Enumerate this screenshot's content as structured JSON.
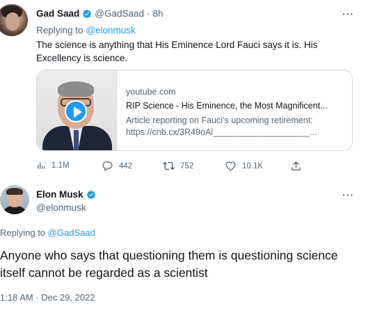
{
  "tweet1": {
    "author_name": "Gad Saad",
    "author_handle": "@GadSaad",
    "separator": "·",
    "time": "8h",
    "replying_prefix": "Replying to",
    "replying_to": "@elonmusk",
    "text": "The science is anything that His Eminence Lord Fauci says it is. His Excellency is science.",
    "card": {
      "domain": "youtube.com",
      "title": "RIP Science - His Eminence, the Most Magnificent...",
      "description_line1": "Article reporting on Fauci’s upcoming retirement:",
      "description_line2": "https://cnb.cx/3R49oAl____________________..."
    },
    "actions": {
      "views": "1.1M",
      "replies": "442",
      "retweets": "752",
      "likes": "10.1K"
    },
    "more_icon": "more-horizontal-icon"
  },
  "tweet2": {
    "author_name": "Elon Musk",
    "author_handle": "@elonmusk",
    "replying_prefix": "Replying to",
    "replying_to": "@GadSaad",
    "text": "Anyone who says that questioning them is questioning science itself cannot be regarded as a scientist",
    "timestamp": "1:18 AM · Dec 29, 2022",
    "more_icon": "more-horizontal-icon"
  },
  "colors": {
    "accent": "#1d9bf0",
    "text": "#0f1419",
    "secondary": "#536471",
    "border": "#cfd9de"
  }
}
